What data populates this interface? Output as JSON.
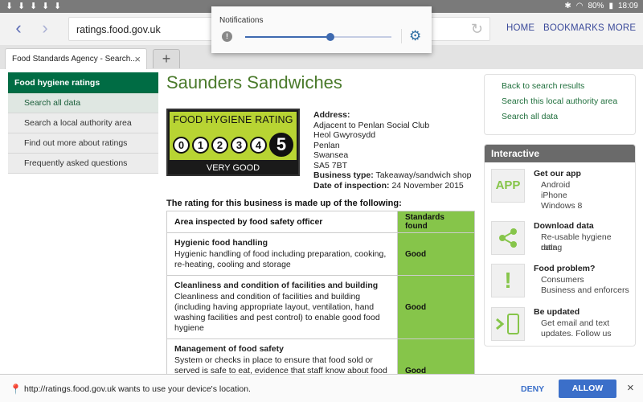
{
  "status": {
    "battery": "80%",
    "time": "18:09"
  },
  "toolbar": {
    "url": "ratings.food.gov.uk",
    "home": "HOME",
    "bookmarks": "BOOKMARKS",
    "more": "MORE"
  },
  "tab": {
    "title": "Food Standards Agency - Search...",
    "close": "×",
    "new": "+"
  },
  "notification": {
    "title": "Notifications",
    "slider_level": 0.58
  },
  "sidebar": {
    "header": "Food hygiene ratings",
    "items": [
      {
        "label": "Search all data"
      },
      {
        "label": "Search a local authority area"
      },
      {
        "label": "Find out more about ratings"
      },
      {
        "label": "Frequently asked questions"
      }
    ]
  },
  "business": {
    "name": "Saunders Sandwiches",
    "badge": {
      "title": "FOOD HYGIENE RATING",
      "numbers": [
        "0",
        "1",
        "2",
        "3",
        "4",
        "5"
      ],
      "selected": "5",
      "word": "VERY GOOD"
    },
    "address_label": "Address:",
    "address_lines": [
      "Adjacent to Penlan Social Club",
      "Heol Gwyrosydd",
      "Penlan",
      "Swansea",
      "SA5 7BT"
    ],
    "type_label": "Business type:",
    "type_value": "Takeaway/sandwich shop",
    "date_label": "Date of inspection:",
    "date_value": "24 November 2015"
  },
  "rating_table": {
    "intro": "The rating for this business is made up of the following:",
    "col1": "Area inspected by food safety officer",
    "col2": "Standards found",
    "rows": [
      {
        "heading": "Hygienic food handling",
        "text": "Hygienic handling of food including preparation, cooking, re-heating, cooling and storage",
        "result": "Good"
      },
      {
        "heading": "Cleanliness and condition of facilities and building",
        "text": "Cleanliness and condition of facilities and building (including having appropriate layout, ventilation, hand washing facilities and pest control) to enable good food hygiene",
        "result": "Good"
      },
      {
        "heading": "Management of food safety",
        "text": "System or checks in place to ensure that food sold or served is safe to eat, evidence that staff know about food safety, and the food safety officer has confidence that standards",
        "result": "Good"
      }
    ]
  },
  "links": [
    "Back to search results",
    "Search this local authority area",
    "Search all data"
  ],
  "interactive": {
    "header": "Interactive",
    "items": [
      {
        "icon": "app-icon",
        "icon_text": "APP",
        "title": "Get our app",
        "lines": [
          "Android",
          "iPhone",
          "Windows 8"
        ]
      },
      {
        "icon": "share-icon",
        "title": "Download data",
        "lines": [
          "Re-usable hygiene rating",
          "data"
        ]
      },
      {
        "icon": "exclamation-icon",
        "title": "Food problem?",
        "lines": [
          "Consumers",
          "Business and enforcers"
        ]
      },
      {
        "icon": "phone-icon",
        "title": "Be updated",
        "lines": [
          "Get email and text",
          "updates. Follow us"
        ]
      }
    ]
  },
  "permission": {
    "message": "http://ratings.food.gov.uk wants to use your device's location.",
    "deny": "DENY",
    "allow": "ALLOW",
    "close": "×"
  },
  "colors": {
    "brand_green": "#006c44",
    "rating_green": "#86c54a",
    "badge_green": "#b8d433",
    "accent_blue": "#3b6fc9"
  }
}
